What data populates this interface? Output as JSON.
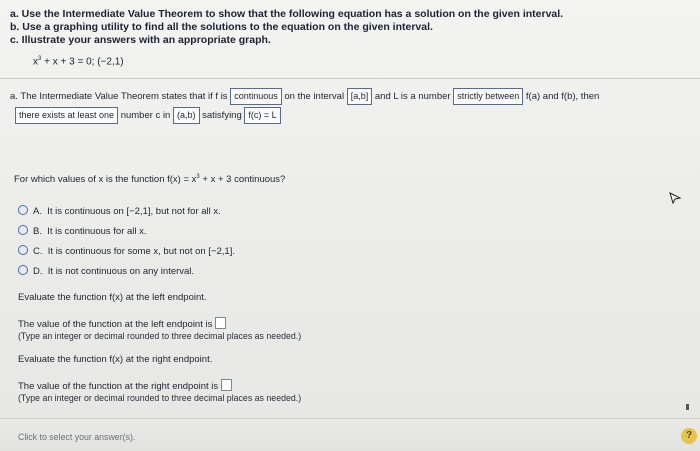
{
  "problem": {
    "a": "a. Use the Intermediate Value Theorem to show that the following equation has a solution on the given interval.",
    "b": "b. Use a graphing utility to find all the solutions to the equation on the given interval.",
    "c": "c. Illustrate your answers with an appropriate graph.",
    "equation_prefix": "x",
    "equation_exp": "3",
    "equation_rest": " + x + 3 = 0; (−2,1)"
  },
  "ivt": {
    "p1": "a. The Intermediate Value Theorem states that if f is",
    "box1": "continuous",
    "p2": "on the interval",
    "box2": "[a,b]",
    "p3": "and L is a number",
    "box3": "strictly between",
    "p4": "f(a) and f(b), then",
    "box4": "there exists at least one",
    "p5": "number c in",
    "box5": "(a,b)",
    "p6": "satisfying",
    "box6": "f(c) = L"
  },
  "question": {
    "prefix": "For which values of x is the function f(x) = x",
    "exp": "3",
    "suffix": " + x + 3 continuous?"
  },
  "options": [
    {
      "letter": "A.",
      "text": "It is continuous on [−2,1], but not for all x."
    },
    {
      "letter": "B.",
      "text": "It is continuous for all x."
    },
    {
      "letter": "C.",
      "text": "It is continuous for some x, but not on [−2,1]."
    },
    {
      "letter": "D.",
      "text": "It is not continuous on any interval."
    }
  ],
  "left": {
    "prompt": "Evaluate the function f(x) at the left endpoint.",
    "answer_label": "The value of the function at the left endpoint is",
    "hint": "(Type an integer or decimal rounded to three decimal places as needed.)"
  },
  "right": {
    "prompt": "Evaluate the function f(x) at the right endpoint.",
    "answer_label": "The value of the function at the right endpoint is",
    "hint": "(Type an integer or decimal rounded to three decimal places as needed.)"
  },
  "footer": {
    "select_text": "Click to select your answer(s).",
    "help": "?"
  }
}
